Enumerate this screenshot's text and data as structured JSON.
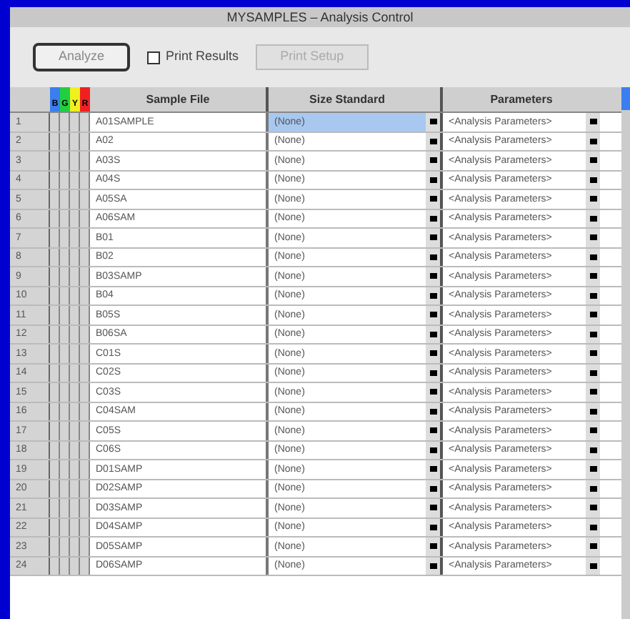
{
  "window": {
    "title": "MYSAMPLES – Analysis Control"
  },
  "toolbar": {
    "analyze_button": "Analyze",
    "print_results": {
      "label": "Print Results",
      "checked": false
    },
    "print_setup_button": "Print Setup"
  },
  "table": {
    "columns": [
      "Sample File",
      "Size Standard",
      "Parameters"
    ],
    "dye_columns": [
      {
        "label": "B",
        "color": "#3a7ef0"
      },
      {
        "label": "G",
        "color": "#20d040"
      },
      {
        "label": "Y",
        "color": "#f0f020"
      },
      {
        "label": "R",
        "color": "#f02020"
      }
    ],
    "rows": [
      {
        "number": "1",
        "sample": "A01SAMPLE",
        "size_standard": "(None)",
        "parameters": "<Analysis Parameters>",
        "selected": true
      },
      {
        "number": "2",
        "sample": "A02",
        "size_standard": "(None)",
        "parameters": "<Analysis Parameters>",
        "selected": false
      },
      {
        "number": "3",
        "sample": "A03S",
        "size_standard": "(None)",
        "parameters": "<Analysis Parameters>",
        "selected": false
      },
      {
        "number": "4",
        "sample": "A04S",
        "size_standard": "(None)",
        "parameters": "<Analysis Parameters>",
        "selected": false
      },
      {
        "number": "5",
        "sample": "A05SA",
        "size_standard": "(None)",
        "parameters": "<Analysis Parameters>",
        "selected": false
      },
      {
        "number": "6",
        "sample": "A06SAM",
        "size_standard": "(None)",
        "parameters": "<Analysis Parameters>",
        "selected": false
      },
      {
        "number": "7",
        "sample": "B01",
        "size_standard": "(None)",
        "parameters": "<Analysis Parameters>",
        "selected": false
      },
      {
        "number": "8",
        "sample": "B02",
        "size_standard": "(None)",
        "parameters": "<Analysis Parameters>",
        "selected": false
      },
      {
        "number": "9",
        "sample": "B03SAMP",
        "size_standard": "(None)",
        "parameters": "<Analysis Parameters>",
        "selected": false
      },
      {
        "number": "10",
        "sample": "B04",
        "size_standard": "(None)",
        "parameters": "<Analysis Parameters>",
        "selected": false
      },
      {
        "number": "11",
        "sample": "B05S",
        "size_standard": "(None)",
        "parameters": "<Analysis Parameters>",
        "selected": false
      },
      {
        "number": "12",
        "sample": "B06SA",
        "size_standard": "(None)",
        "parameters": "<Analysis Parameters>",
        "selected": false
      },
      {
        "number": "13",
        "sample": "C01S",
        "size_standard": "(None)",
        "parameters": "<Analysis Parameters>",
        "selected": false
      },
      {
        "number": "14",
        "sample": "C02S",
        "size_standard": "(None)",
        "parameters": "<Analysis Parameters>",
        "selected": false
      },
      {
        "number": "15",
        "sample": "C03S",
        "size_standard": "(None)",
        "parameters": "<Analysis Parameters>",
        "selected": false
      },
      {
        "number": "16",
        "sample": "C04SAM",
        "size_standard": "(None)",
        "parameters": "<Analysis Parameters>",
        "selected": false
      },
      {
        "number": "17",
        "sample": "C05S",
        "size_standard": "(None)",
        "parameters": "<Analysis Parameters>",
        "selected": false
      },
      {
        "number": "18",
        "sample": "C06S",
        "size_standard": "(None)",
        "parameters": "<Analysis Parameters>",
        "selected": false
      },
      {
        "number": "19",
        "sample": "D01SAMP",
        "size_standard": "(None)",
        "parameters": "<Analysis Parameters>",
        "selected": false
      },
      {
        "number": "20",
        "sample": "D02SAMP",
        "size_standard": "(None)",
        "parameters": "<Analysis Parameters>",
        "selected": false
      },
      {
        "number": "21",
        "sample": "D03SAMP",
        "size_standard": "(None)",
        "parameters": "<Analysis Parameters>",
        "selected": false
      },
      {
        "number": "22",
        "sample": "D04SAMP",
        "size_standard": "(None)",
        "parameters": "<Analysis Parameters>",
        "selected": false
      },
      {
        "number": "23",
        "sample": "D05SAMP",
        "size_standard": "(None)",
        "parameters": "<Analysis Parameters>",
        "selected": false
      },
      {
        "number": "24",
        "sample": "D06SAMP",
        "size_standard": "(None)",
        "parameters": "<Analysis Parameters>",
        "selected": false
      }
    ]
  }
}
